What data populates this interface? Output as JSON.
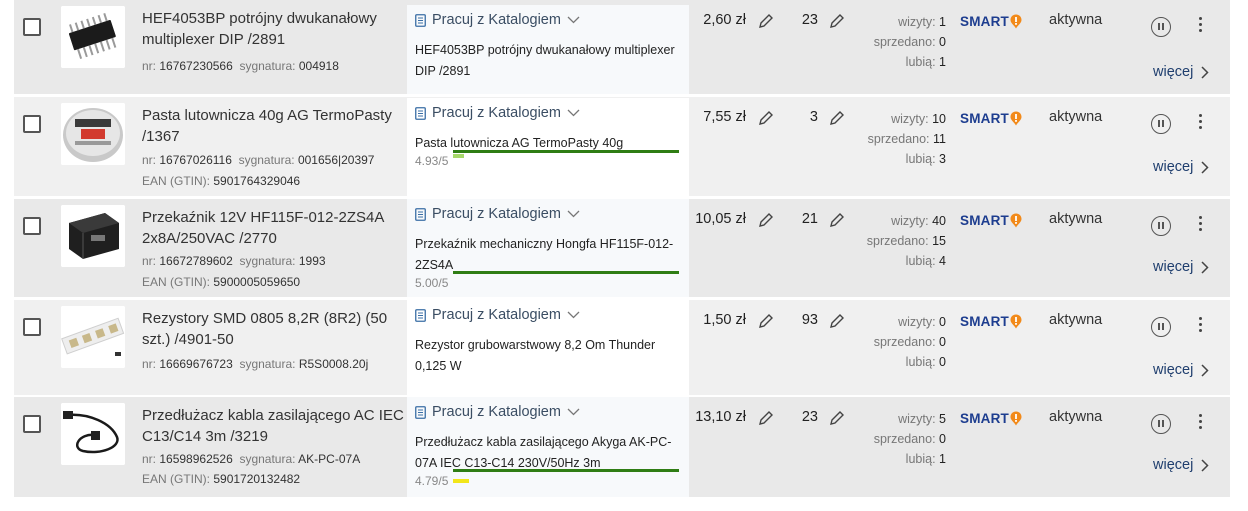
{
  "common": {
    "catalog_label": "Pracuj z Katalogiem",
    "nr_label": "nr:",
    "sig_label": "sygnatura:",
    "ean_label": "EAN (GTIN):",
    "views_label": "wizyty:",
    "sold_label": "sprzedano:",
    "likes_label": "lubią:",
    "smart_label": "SMART",
    "more_label": "więcej"
  },
  "rows": [
    {
      "title": "HEF4053BP potrójny dwukanałowy multiplexer DIP /2891",
      "nr": "16767230566",
      "signature": "004918",
      "ean": "",
      "catalog_name": "HEF4053BP potrójny dwukanałowy multiplexer DIP /2891",
      "quality_score": "",
      "quality": 0,
      "price": "2,60 zł",
      "qty": "23",
      "views": "1",
      "sold": "0",
      "likes": "1",
      "status": "aktywna",
      "thumb": "ic-chip"
    },
    {
      "title": "Pasta lutownicza 40g AG TermoPasty /1367",
      "nr": "16767026116",
      "signature": "001656|20397",
      "ean": "5901764329046",
      "catalog_name": "Pasta lutownicza AG TermoPasty 40g",
      "quality_score": "4.93/5",
      "quality": 0.05,
      "quality_color": "#a6d86a",
      "price": "7,55 zł",
      "qty": "3",
      "views": "10",
      "sold": "11",
      "likes": "3",
      "status": "aktywna",
      "thumb": "solder-paste-tin"
    },
    {
      "title": "Przekaźnik 12V HF115F-012-2ZS4A 2x8A/250VAC /2770",
      "nr": "16672789602",
      "signature": "1993",
      "ean": "5900005059650",
      "catalog_name": "Przekaźnik mechaniczny Hongfa HF115F-012-2ZS4A",
      "quality_score": "5.00/5",
      "quality": 0,
      "price": "10,05 zł",
      "qty": "21",
      "views": "40",
      "sold": "15",
      "likes": "4",
      "status": "aktywna",
      "thumb": "relay"
    },
    {
      "title": "Rezystory SMD 0805 8,2R (8R2) (50 szt.) /4901-50",
      "nr": "16669676723",
      "signature": "R5S0008.20j",
      "ean": "",
      "catalog_name": "Rezystor grubowarstwowy 8,2 Om Thunder 0,125 W",
      "quality_score": "",
      "quality": 0,
      "price": "1,50 zł",
      "qty": "93",
      "views": "0",
      "sold": "0",
      "likes": "0",
      "status": "aktywna",
      "thumb": "smd-tape"
    },
    {
      "title": "Przedłużacz kabla zasilającego AC IEC C13/C14 3m /3219",
      "nr": "16598962526",
      "signature": "AK-PC-07A",
      "ean": "5901720132482",
      "catalog_name": "Przedłużacz kabla zasilającego Akyga AK-PC-07A IEC C13-C14 230V/50Hz 3m",
      "quality_score": "4.79/5",
      "quality": 0.07,
      "quality_color": "#f2e61a",
      "price": "13,10 zł",
      "qty": "23",
      "views": "5",
      "sold": "0",
      "likes": "1",
      "status": "aktywna",
      "thumb": "power-cable"
    }
  ],
  "colors": {
    "smart_badge": "#f28a1a",
    "quality_line": "#2f7d14",
    "more_link": "#1f3e6e"
  }
}
